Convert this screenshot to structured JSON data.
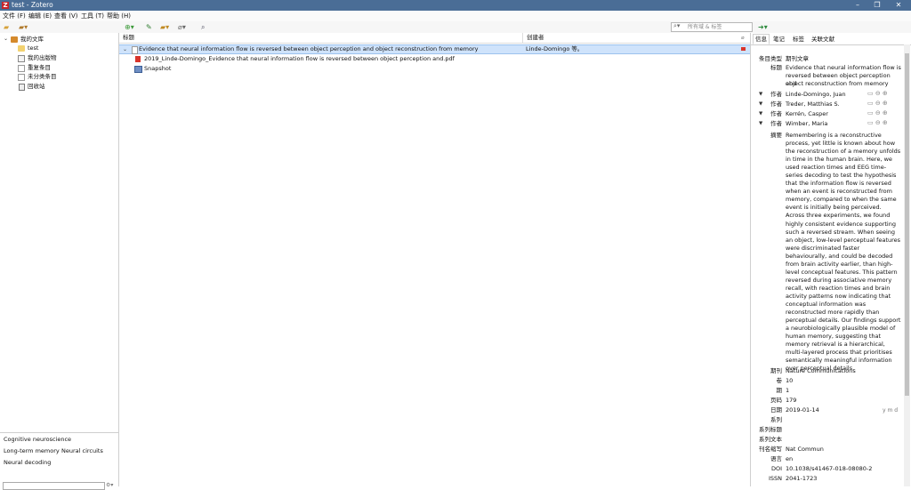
{
  "window": {
    "title": "test - Zotero",
    "app_letter": "Z"
  },
  "menu": [
    "文件 (F)",
    "编辑 (E)",
    "查看 (V)",
    "工具 (T)",
    "帮助 (H)"
  ],
  "search": {
    "placeholder": "所有域 & 标签"
  },
  "library": {
    "root": "我的文库",
    "items": [
      "test",
      "我的出版物",
      "重复条目",
      "未分类条目",
      "回收站"
    ]
  },
  "tags": [
    "Cognitive neuroscience",
    "Long-term memory",
    "Neural circuits",
    "Neural decoding"
  ],
  "items_list": {
    "col_title": "标题",
    "col_creator": "创建者",
    "rows": [
      {
        "title": "Evidence that neural information flow is reversed between object perception and object reconstruction from memory",
        "creator": "Linde-Domingo 等。"
      },
      {
        "title": "2019_Linde-Domingo_Evidence that neural information flow is reversed between object perception and.pdf",
        "creator": ""
      },
      {
        "title": "Snapshot",
        "creator": ""
      }
    ]
  },
  "tabs": [
    "信息",
    "笔记",
    "标签",
    "关联文献"
  ],
  "info": {
    "item_type_label": "条目类型",
    "item_type": "期刊文章",
    "title_label": "标题",
    "title_lines": [
      "Evidence that neural information flow is",
      "reversed between object perception and",
      "object reconstruction from memory"
    ],
    "creator_label": "作者",
    "creators": [
      "Linde-Domingo, Juan",
      "Treder, Matthias S.",
      "Kerrén, Casper",
      "Wimber, Maria"
    ],
    "abstract_label": "摘要",
    "abstract": "Remembering is a reconstructive process, yet little is known about how the reconstruction of a memory unfolds in time in the human brain. Here, we used reaction times and EEG time-series decoding to test the hypothesis that the information flow is reversed when an event is reconstructed from memory, compared to when the same event is initially being perceived. Across three experiments, we found highly consistent evidence supporting such a reversed stream. When seeing an object, low-level perceptual features were discriminated faster behaviourally, and could be decoded from brain activity earlier, than high-level conceptual features. This pattern reversed during associative memory recall, with reaction times and brain activity patterns now indicating that conceptual information was reconstructed more rapidly than perceptual details. Our findings support a neurobiologically plausible model of human memory, suggesting that memory retrieval is a hierarchical, multi-layered process that prioritises semantically meaningful information over perceptual details.",
    "fields": [
      {
        "label": "期刊",
        "value": "Nature Communications"
      },
      {
        "label": "卷",
        "value": "10"
      },
      {
        "label": "期",
        "value": "1"
      },
      {
        "label": "页码",
        "value": "179"
      },
      {
        "label": "日期",
        "value": "2019-01-14"
      },
      {
        "label": "系列",
        "value": ""
      },
      {
        "label": "系列标题",
        "value": ""
      },
      {
        "label": "系列文本",
        "value": ""
      },
      {
        "label": "刊名缩写",
        "value": "Nat Commun"
      },
      {
        "label": "语言",
        "value": "en"
      },
      {
        "label": "DOI",
        "value": "10.1038/s41467-018-08080-2"
      },
      {
        "label": "ISSN",
        "value": "2041-1723"
      }
    ],
    "date_format": "y m d"
  }
}
